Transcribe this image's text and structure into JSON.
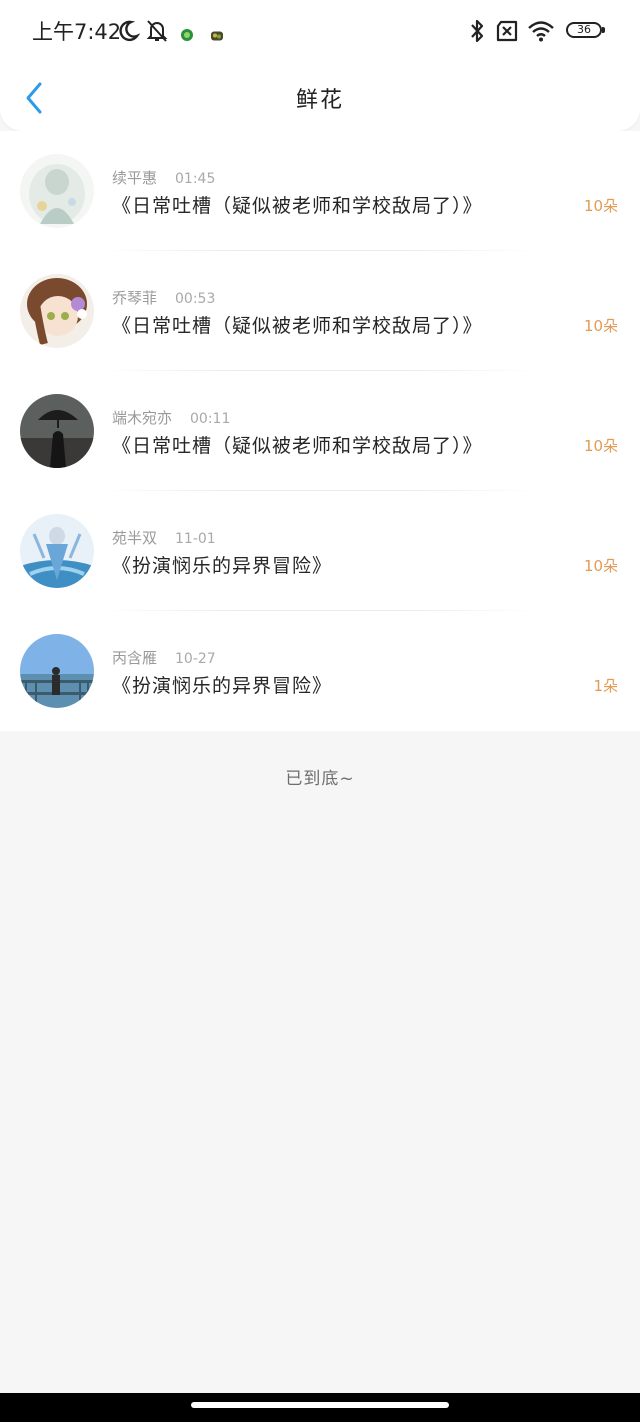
{
  "status_bar": {
    "time": "上午7:42",
    "battery_level": "36",
    "icons": [
      "moon-icon",
      "bell-off-icon",
      "app-notification-icon",
      "app-notification-icon",
      "bluetooth-icon",
      "no-sim-icon",
      "wifi-icon",
      "battery-icon"
    ]
  },
  "nav": {
    "title": "鲜花",
    "back_icon": "chevron-left-icon",
    "accent_color": "#2e9be6"
  },
  "rows": [
    {
      "name": "续平惠",
      "time": "01:45",
      "title": "《日常吐槽（疑似被老师和学校敌局了）》",
      "count": "10朵"
    },
    {
      "name": "乔琴菲",
      "time": "00:53",
      "title": "《日常吐槽（疑似被老师和学校敌局了）》",
      "count": "10朵"
    },
    {
      "name": "端木宛亦",
      "time": "00:11",
      "title": "《日常吐槽（疑似被老师和学校敌局了）》",
      "count": "10朵"
    },
    {
      "name": "苑半双",
      "time": "11-01",
      "title": "《扮演悯乐的异界冒险》",
      "count": "10朵"
    },
    {
      "name": "丙含雁",
      "time": "10-27",
      "title": "《扮演悯乐的异界冒险》",
      "count": "1朵"
    }
  ],
  "footer": {
    "end_text": "已到底~"
  },
  "colors": {
    "count": "#e39a55",
    "meta": "#9a9a9a",
    "background": "#f7f6f6"
  }
}
